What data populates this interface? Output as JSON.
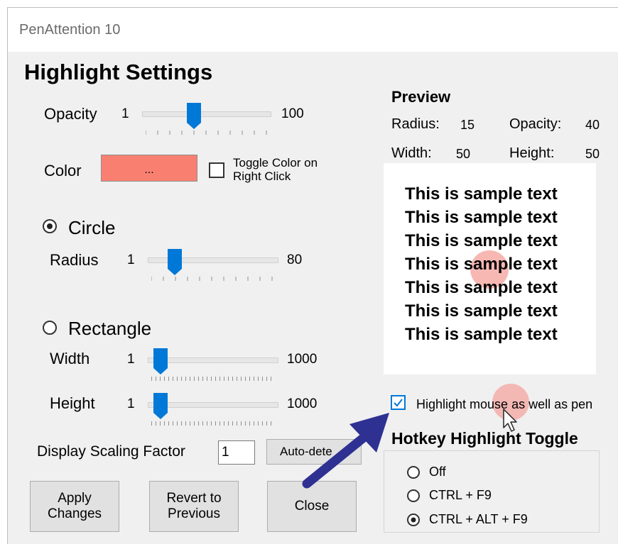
{
  "window": {
    "title": "PenAttention 10"
  },
  "highlight": {
    "heading": "Highlight Settings",
    "opacity": {
      "label": "Opacity",
      "min": "1",
      "max": "100",
      "value_fraction": 0.4
    },
    "color": {
      "label": "Color",
      "button_label": "...",
      "swatch_hex": "#f98071",
      "toggle_label": "Toggle Color on\nRight Click",
      "toggle_checked": false
    },
    "circle": {
      "label": "Circle",
      "selected": true,
      "radius": {
        "label": "Radius",
        "min": "1",
        "max": "80",
        "value_fraction": 0.18
      }
    },
    "rectangle": {
      "label": "Rectangle",
      "selected": false,
      "width": {
        "label": "Width",
        "min": "1",
        "max": "1000",
        "value_fraction": 0.05
      },
      "height": {
        "label": "Height",
        "min": "1",
        "max": "1000",
        "value_fraction": 0.05
      }
    },
    "scaling": {
      "label": "Display Scaling Factor",
      "value": "1",
      "auto_button": "Auto-dete"
    }
  },
  "buttons": {
    "apply": "Apply\nChanges",
    "revert": "Revert to\nPrevious",
    "close": "Close"
  },
  "preview": {
    "heading": "Preview",
    "radius_label": "Radius:",
    "radius_value": "15",
    "opacity_label": "Opacity:",
    "opacity_value": "40",
    "width_label": "Width:",
    "width_value": "50",
    "height_label": "Height:",
    "height_value": "50",
    "sample_lines": [
      "This is sample text",
      "This is sample text",
      "This is sample text",
      "This is sample text",
      "This is sample text",
      "This is sample text",
      "This is sample text"
    ]
  },
  "mouse_highlight": {
    "label": "Highlight mouse as well as pen",
    "checked": true
  },
  "hotkey": {
    "heading": "Hotkey Highlight Toggle",
    "options": [
      {
        "label": "Off",
        "selected": false
      },
      {
        "label": "CTRL + F9",
        "selected": false
      },
      {
        "label": "CTRL + ALT + F9",
        "selected": true
      }
    ]
  },
  "colors": {
    "accent": "#0078d7",
    "swatch": "#f98071",
    "highlight_circle": "#f4a09a",
    "arrow": "#2e3192"
  },
  "icons": [
    "slider-thumb-icon",
    "radio-icon",
    "checkbox-icon",
    "check-mark-icon",
    "mouse-cursor-icon",
    "annotation-arrow-icon"
  ]
}
